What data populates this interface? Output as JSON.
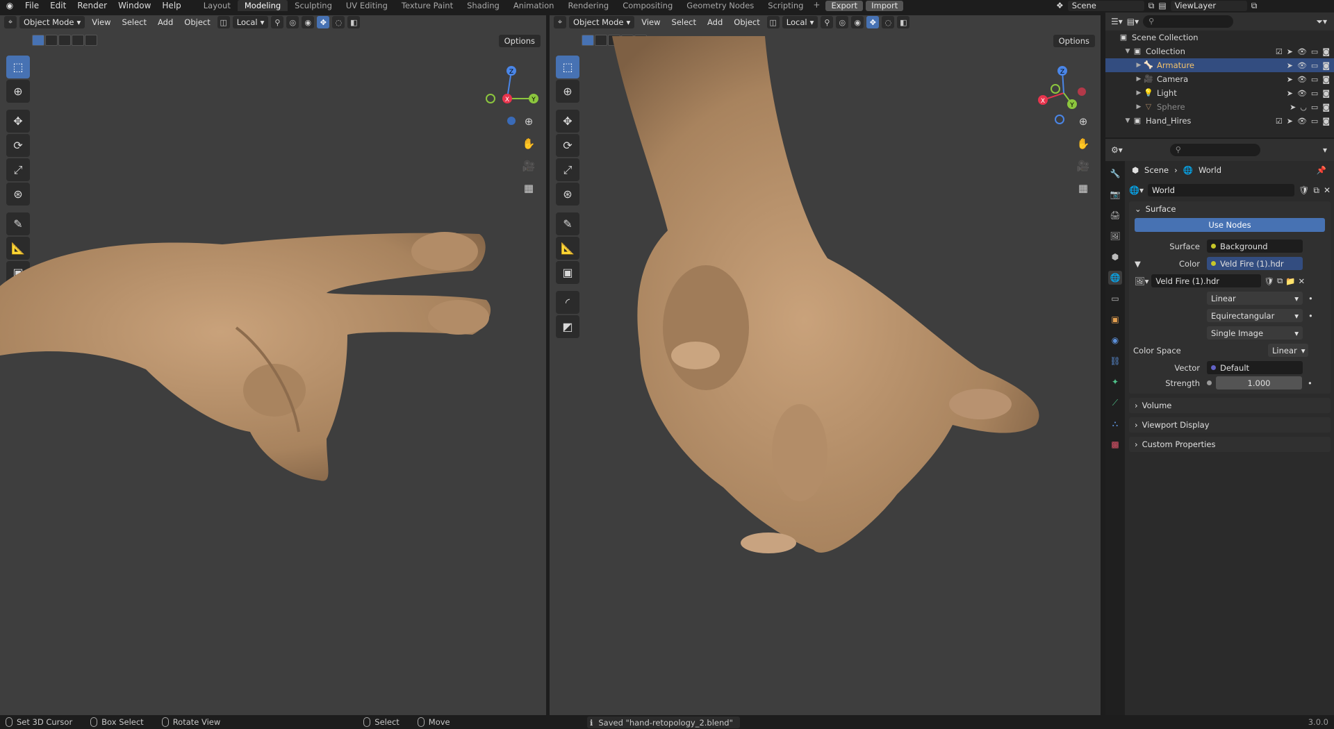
{
  "topbar": {
    "menus": [
      "File",
      "Edit",
      "Render",
      "Window",
      "Help"
    ],
    "workspaces": [
      "Layout",
      "Modeling",
      "Sculpting",
      "UV Editing",
      "Texture Paint",
      "Shading",
      "Animation",
      "Rendering",
      "Compositing",
      "Geometry Nodes",
      "Scripting"
    ],
    "active_workspace": "Modeling",
    "export_label": "Export",
    "import_label": "Import",
    "scene": "Scene",
    "view_layer": "ViewLayer"
  },
  "viewport": {
    "mode": "Object Mode",
    "menus": [
      "View",
      "Select",
      "Add",
      "Object"
    ],
    "orientation": "Local",
    "options": "Options"
  },
  "outliner": {
    "rows": [
      {
        "label": "Scene Collection",
        "icon": "collection-icon"
      },
      {
        "label": "Collection",
        "icon": "collection-icon"
      },
      {
        "label": "Armature",
        "icon": "armature-icon",
        "selected": true
      },
      {
        "label": "Camera",
        "icon": "camera-icon"
      },
      {
        "label": "Light",
        "icon": "light-icon"
      },
      {
        "label": "Sphere",
        "icon": "mesh-icon"
      },
      {
        "label": "Hand_Hires",
        "icon": "collection-icon"
      }
    ]
  },
  "properties": {
    "breadcrumb_scene": "Scene",
    "breadcrumb_world": "World",
    "world_name": "World",
    "surface_panel": "Surface",
    "use_nodes": "Use Nodes",
    "surface_label": "Surface",
    "surface_value": "Background",
    "color_label": "Color",
    "color_value": "Veld Fire (1).hdr",
    "image_name": "Veld Fire (1).hdr",
    "interpolation": "Linear",
    "projection": "Equirectangular",
    "source": "Single Image",
    "color_space_label": "Color Space",
    "color_space_value": "Linear",
    "vector_label": "Vector",
    "vector_value": "Default",
    "strength_label": "Strength",
    "strength_value": "1.000",
    "panels": [
      "Volume",
      "Viewport Display",
      "Custom Properties"
    ]
  },
  "statusbar": {
    "set_cursor": "Set 3D Cursor",
    "box_select": "Box Select",
    "rotate_view": "Rotate View",
    "select": "Select",
    "move": "Move",
    "message": "Saved \"hand-retopology_2.blend\"",
    "version": "3.0.0"
  },
  "colors": {
    "accent": "#4772b3",
    "skin": "#b7916c",
    "viewport_bg": "#3e3e3e"
  }
}
